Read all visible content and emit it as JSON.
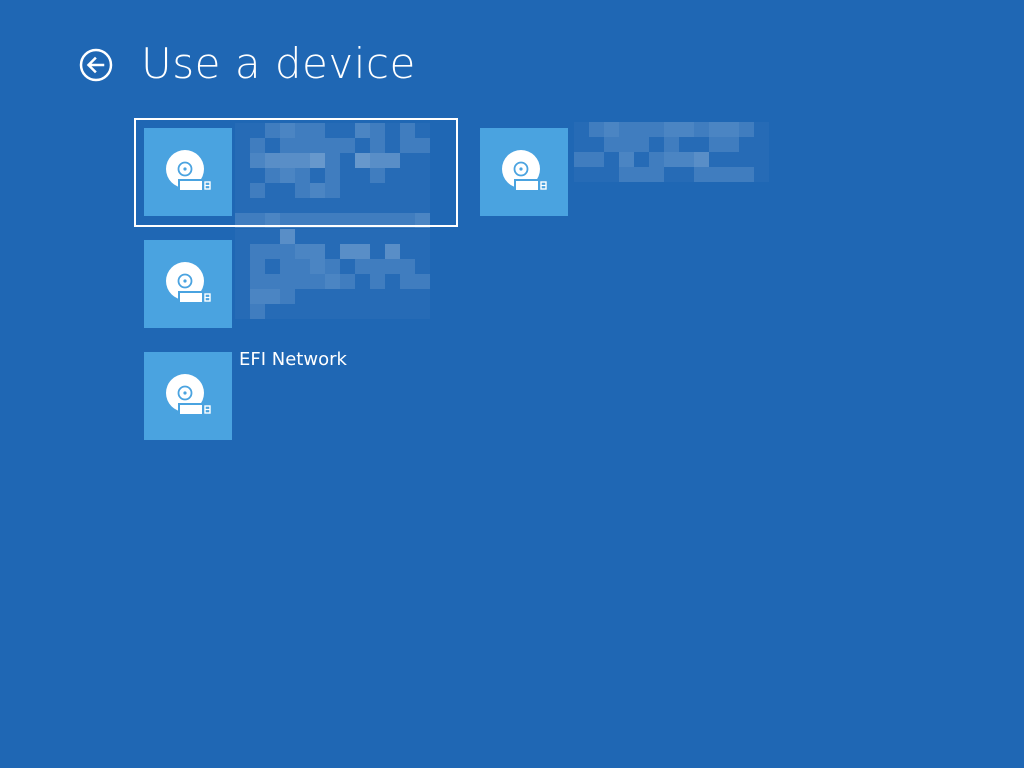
{
  "page": {
    "title": "Use a device"
  },
  "devices": [
    {
      "label": "",
      "icon": "usb-drive-icon",
      "redacted": true
    },
    {
      "label": "",
      "icon": "usb-drive-icon",
      "redacted": true
    },
    {
      "label": "",
      "icon": "usb-drive-icon",
      "redacted": true
    },
    {
      "label": "EFI Network",
      "icon": "usb-drive-icon",
      "redacted": false
    }
  ],
  "colors": {
    "background": "#1f67b4",
    "tile": "#4aa3e0",
    "text": "#ffffff",
    "selection": "#ffffff"
  }
}
